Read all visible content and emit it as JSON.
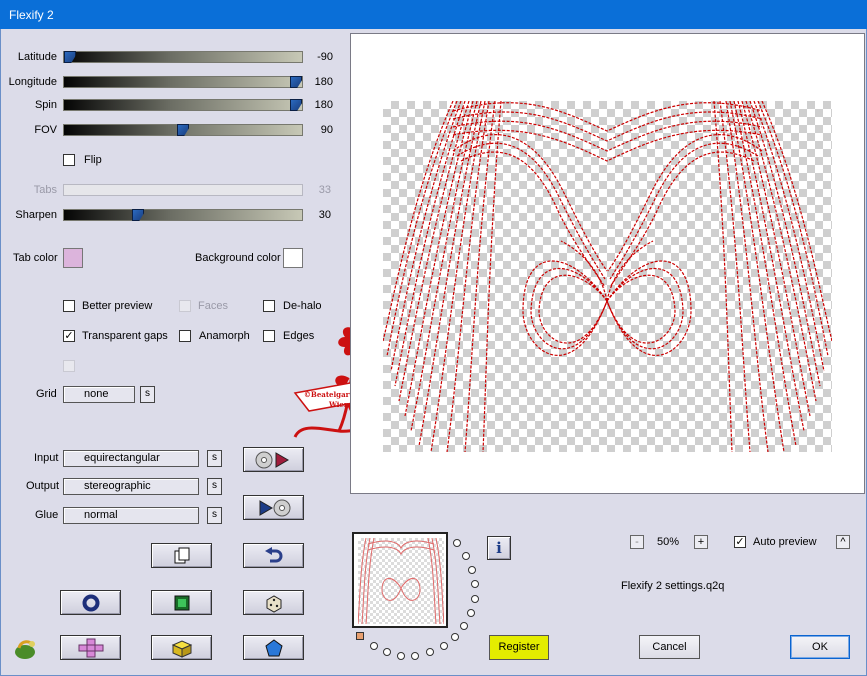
{
  "window": {
    "title": "Flexify 2"
  },
  "sliders": [
    {
      "label": "Latitude",
      "value": "-90",
      "fraction": 0.0
    },
    {
      "label": "Longitude",
      "value": "180",
      "fraction": 1.0
    },
    {
      "label": "Spin",
      "value": "180",
      "fraction": 1.0
    },
    {
      "label": "FOV",
      "value": "90",
      "fraction": 0.5
    }
  ],
  "flip": {
    "label": "Flip",
    "checked": false
  },
  "tabs": {
    "label": "Tabs",
    "value": "33",
    "enabled": false
  },
  "sharpen": {
    "label": "Sharpen",
    "value": "30",
    "fraction": 0.3
  },
  "colors": {
    "tab_label": "Tab color",
    "tab_color": "#dcb4dc",
    "background_label": "Background color",
    "background_color": "#ffffff"
  },
  "options": {
    "better_preview": "Better preview",
    "faces": "Faces",
    "de_halo": "De-halo",
    "transparent_gaps": "Transparent gaps",
    "anamorph": "Anamorph",
    "edges": "Edges"
  },
  "grid": {
    "label": "Grid",
    "value": "none"
  },
  "input": {
    "label": "Input",
    "value": "equirectangular"
  },
  "output": {
    "label": "Output",
    "value": "stereographic"
  },
  "glue": {
    "label": "Glue",
    "value": "normal"
  },
  "small_button_label": "s",
  "watermark": "©Beatelgarten Wien",
  "zoom": {
    "minus": "-",
    "value": "50%",
    "plus": "+"
  },
  "auto_preview": {
    "label": "Auto preview",
    "checked": true,
    "btn": "^"
  },
  "settings_file": "Flexify 2 settings.q2q",
  "info_label": "i",
  "buttons": {
    "register": "Register",
    "cancel": "Cancel",
    "ok": "OK"
  },
  "accent_colors": {
    "title_bar": "#0a6fd8",
    "register": "#e4ec00",
    "lines": "#cc0000"
  }
}
